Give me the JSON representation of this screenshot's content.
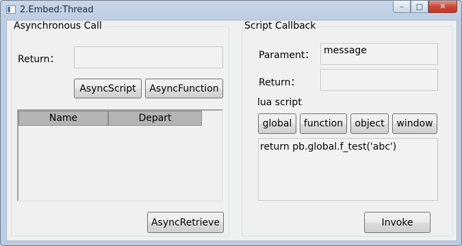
{
  "window": {
    "title": "2.Embed:Thread"
  },
  "async": {
    "group_title": "Asynchronous Call",
    "return_label": "Return：",
    "return_value": "",
    "async_script_btn": "AsyncScript",
    "async_function_btn": "AsyncFunction",
    "columns": [
      "Name",
      "Depart"
    ],
    "rows": [],
    "async_retrieve_btn": "AsyncRetrieve"
  },
  "callback": {
    "group_title": "Script Callback",
    "parament_label": "Parament：",
    "parament_value": "message",
    "return_label": "Return：",
    "return_value": "",
    "lua_label": "lua script",
    "buttons": [
      "global",
      "function",
      "object",
      "window"
    ],
    "script_text": "return pb.global.f_test('abc')",
    "invoke_btn": "Invoke"
  }
}
